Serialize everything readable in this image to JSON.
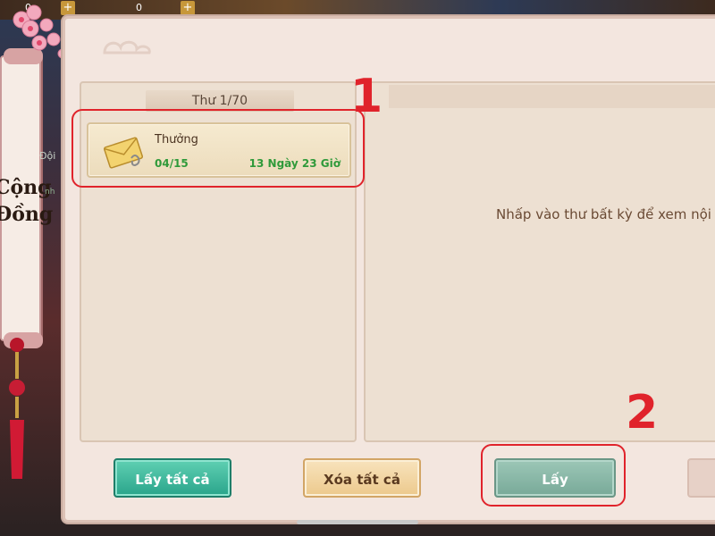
{
  "topbar": {
    "resource_value": "0",
    "plus_symbol": "+"
  },
  "side_banner": {
    "text": "Cộng Đồng",
    "hint_1": "Đội",
    "hint_2": "nh"
  },
  "mail_list": {
    "header": "Thư 1/70",
    "items": [
      {
        "title": "Thưởng",
        "date": "04/15",
        "expire": "13 Ngày 23 Giờ",
        "icon": "envelope-icon"
      }
    ]
  },
  "content": {
    "hint": "Nhấp vào thư bất kỳ để xem nội dung"
  },
  "buttons": {
    "take_all": "Lấy tất cả",
    "delete_all": "Xóa tất cả",
    "take": "Lấy"
  },
  "annotations": {
    "step_1": "1",
    "step_2": "2"
  },
  "colors": {
    "accent_green_text": "#2f9a3a",
    "teal_button": "#2aa48a",
    "annotation_red": "#e0232b",
    "panel_bg": "#f3e6df"
  }
}
